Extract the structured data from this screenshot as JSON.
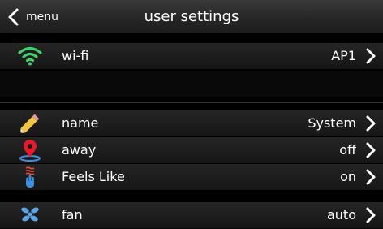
{
  "header": {
    "back_label": "menu",
    "title": "user settings"
  },
  "rows": [
    {
      "icon": "wifi-icon",
      "label": "wi-fi",
      "value": "AP1"
    },
    {
      "icon": "pencil-icon",
      "label": "name",
      "value": "System"
    },
    {
      "icon": "location-pin-icon",
      "label": "away",
      "value": "off"
    },
    {
      "icon": "feels-like-hand-icon",
      "label": "Feels Like",
      "value": "on"
    },
    {
      "icon": "fan-icon",
      "label": "fan",
      "value": "auto"
    }
  ],
  "colors": {
    "wifi": "#3fd16a",
    "pencil": "#f3c541",
    "away_pin": "#e8192c",
    "feels_like_heat": "#e5473d",
    "feels_like_hand": "#3e8fe0",
    "fan": "#5aa5e8"
  }
}
